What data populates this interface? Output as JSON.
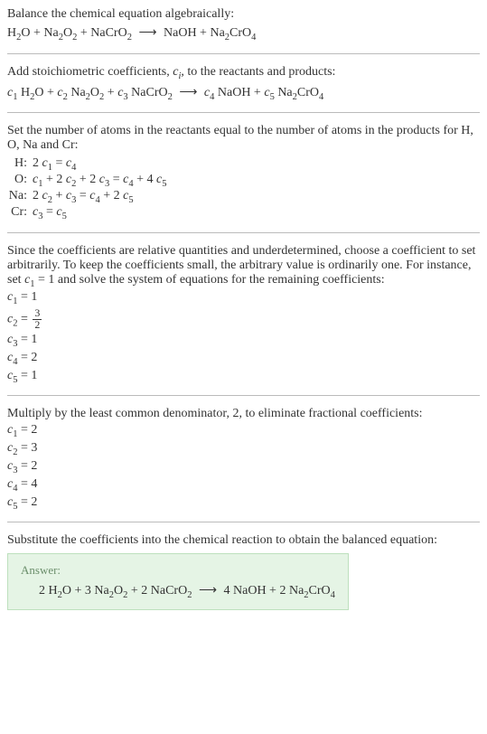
{
  "intro": {
    "line1": "Balance the chemical equation algebraically:",
    "eq_lhs1": "H",
    "eq_lhs1_sub": "2",
    "eq_lhs2": "O + Na",
    "eq_lhs2_sub": "2",
    "eq_lhs3": "O",
    "eq_lhs3_sub": "2",
    "eq_lhs4": " + NaCrO",
    "eq_lhs4_sub": "2",
    "arrow": "⟶",
    "eq_rhs1": "NaOH + Na",
    "eq_rhs1_sub": "2",
    "eq_rhs2": "CrO",
    "eq_rhs2_sub": "4"
  },
  "stoich": {
    "line1a": "Add stoichiometric coefficients, ",
    "ci": "c",
    "ci_sub": "i",
    "line1b": ", to the reactants and products:",
    "c1": "c",
    "c1_sub": "1",
    "sp1": " H",
    "sp1_sub": "2",
    "sp1b": "O + ",
    "c2": "c",
    "c2_sub": "2",
    "sp2": " Na",
    "sp2_sub": "2",
    "sp2b": "O",
    "sp2b_sub": "2",
    "sp2c": " + ",
    "c3": "c",
    "c3_sub": "3",
    "sp3": " NaCrO",
    "sp3_sub": "2",
    "arrow": "⟶",
    "c4": "c",
    "c4_sub": "4",
    "sp4": " NaOH + ",
    "c5": "c",
    "c5_sub": "5",
    "sp5": " Na",
    "sp5_sub": "2",
    "sp5b": "CrO",
    "sp5b_sub": "4"
  },
  "atoms": {
    "intro": "Set the number of atoms in the reactants equal to the number of atoms in the products for H, O, Na and Cr:",
    "rows": [
      {
        "label": "H:",
        "eq_pre": "2 ",
        "c1": "c",
        "c1s": "1",
        "mid": " = ",
        "c2": "c",
        "c2s": "4"
      },
      {
        "label": "O:",
        "eq": "full"
      },
      {
        "label": "Na:",
        "eq": "na"
      },
      {
        "label": "Cr:",
        "eq": "cr"
      }
    ],
    "o_eq": {
      "p1": "c",
      "p1s": "1",
      "p2": " + 2 ",
      "p3": "c",
      "p3s": "2",
      "p4": " + 2 ",
      "p5": "c",
      "p5s": "3",
      "p6": " = ",
      "p7": "c",
      "p7s": "4",
      "p8": " + 4 ",
      "p9": "c",
      "p9s": "5"
    },
    "na_eq": {
      "p1": "2 ",
      "p2": "c",
      "p2s": "2",
      "p3": " + ",
      "p4": "c",
      "p4s": "3",
      "p5": " = ",
      "p6": "c",
      "p6s": "4",
      "p7": " + 2 ",
      "p8": "c",
      "p8s": "5"
    },
    "cr_eq": {
      "p1": "c",
      "p1s": "3",
      "p2": " = ",
      "p3": "c",
      "p3s": "5"
    }
  },
  "arbitrary": {
    "text_a": "Since the coefficients are relative quantities and underdetermined, choose a coefficient to set arbitrarily. To keep the coefficients small, the arbitrary value is ordinarily one. For instance, set ",
    "c1": "c",
    "c1s": "1",
    "text_b": " = 1 and solve the system of equations for the remaining coefficients:",
    "vals": {
      "c1": "c",
      "c1s": "1",
      "v1": " = 1",
      "c2": "c",
      "c2s": "2",
      "v2_eq": " = ",
      "v2_num": "3",
      "v2_den": "2",
      "c3": "c",
      "c3s": "3",
      "v3": " = 1",
      "c4": "c",
      "c4s": "4",
      "v4": " = 2",
      "c5": "c",
      "c5s": "5",
      "v5": " = 1"
    }
  },
  "multiply": {
    "text": "Multiply by the least common denominator, 2, to eliminate fractional coefficients:",
    "vals": {
      "c1": "c",
      "c1s": "1",
      "v1": " = 2",
      "c2": "c",
      "c2s": "2",
      "v2": " = 3",
      "c3": "c",
      "c3s": "3",
      "v3": " = 2",
      "c4": "c",
      "c4s": "4",
      "v4": " = 4",
      "c5": "c",
      "c5s": "5",
      "v5": " = 2"
    }
  },
  "substitute": {
    "text": "Substitute the coefficients into the chemical reaction to obtain the balanced equation:"
  },
  "answer": {
    "label": "Answer:",
    "p1": "2 H",
    "p1s": "2",
    "p2": "O + 3 Na",
    "p2s": "2",
    "p3": "O",
    "p3s": "2",
    "p4": " + 2 NaCrO",
    "p4s": "2",
    "arrow": "⟶",
    "p5": "4 NaOH + 2 Na",
    "p5s": "2",
    "p6": "CrO",
    "p6s": "4"
  }
}
